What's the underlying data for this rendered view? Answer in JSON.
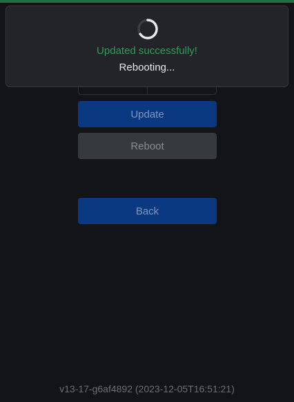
{
  "colors": {
    "top_bar": "#1f6f43",
    "background": "#131417",
    "primary_button": "#0a3981",
    "secondary_button": "#36393d",
    "success_text": "#2e9e5a"
  },
  "toast": {
    "spinner_icon": "loading-spinner-icon",
    "success_message": "Updated successfully!",
    "status_message": "Rebooting..."
  },
  "buttons": {
    "update_label": "Update",
    "reboot_label": "Reboot",
    "back_label": "Back"
  },
  "footer": {
    "version": "v13-17-g6af4892 (2023-12-05T16:51:21)"
  }
}
